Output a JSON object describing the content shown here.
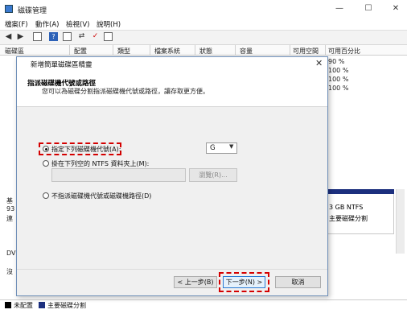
{
  "window": {
    "title": "磁碟管理",
    "minimize": "—",
    "maximize": "☐",
    "close": "✕"
  },
  "menu": [
    "檔案(F)",
    "動作(A)",
    "檢視(V)",
    "說明(H)"
  ],
  "toolbar_icons": [
    "back-arrow-icon",
    "forward-arrow-icon",
    "console-icon",
    "help-icon",
    "list-icon",
    "connect-icon",
    "check-icon",
    "properties-icon"
  ],
  "grid": {
    "columns": [
      "磁碟區",
      "配置",
      "類型",
      "檔案系統",
      "狀態",
      "容量",
      "可用空間",
      "可用百分比"
    ],
    "percent_values": [
      "90 %",
      "100 %",
      "100 %",
      "100 %"
    ]
  },
  "lower": {
    "left_labels": [
      "基",
      "93",
      "連",
      "DV",
      "沒"
    ],
    "volume_size": "3 GB NTFS",
    "volume_status": "主要磁碟分割"
  },
  "legend": {
    "items": [
      {
        "label": "未配置",
        "color": "#000000"
      },
      {
        "label": "主要磁碟分割",
        "color": "#1c2f7e"
      }
    ]
  },
  "dialog": {
    "title": "新增簡單磁碟區精靈",
    "close": "✕",
    "heading": "指派磁碟機代號或路徑",
    "subheading": "您可以為磁碟分割指派磁碟機代號或路徑，讓存取更方便。",
    "option1": "指定下列磁碟機代號(A):",
    "option2": "掛在下列空的 NTFS 資料夾上(M):",
    "option3": "不指派磁碟機代號或磁碟機路徑(D)",
    "drive_letter": "G",
    "browse": "瀏覽(R)...",
    "path_value": "",
    "back": "< 上一步(B)",
    "next": "下一步(N) >",
    "cancel": "取消"
  }
}
